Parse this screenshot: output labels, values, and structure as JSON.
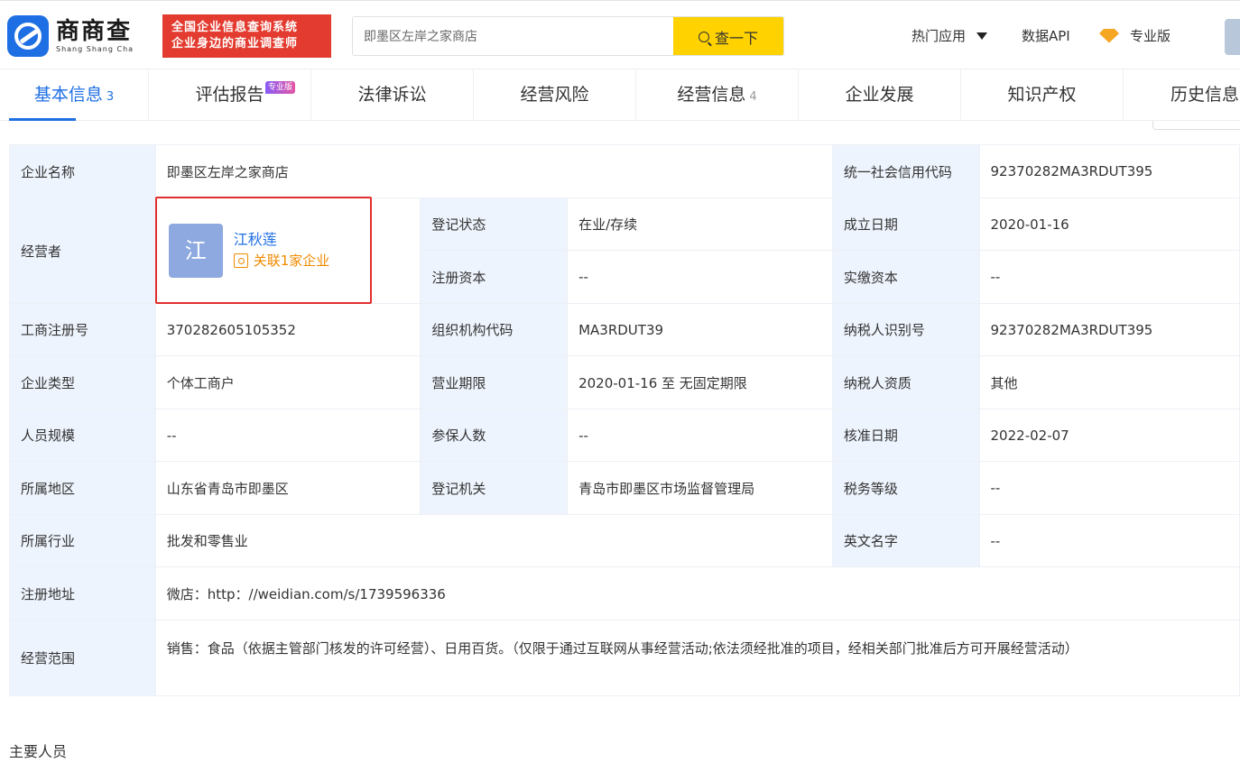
{
  "header": {
    "logo_cn": "商商查",
    "logo_en": "Shang Shang Cha",
    "slogan_line1": "全国企业信息查询系统",
    "slogan_line2": "企业身边的商业调查师",
    "search_value": "即墨区左岸之家商店",
    "search_button": "查一下",
    "hot_apps": "热门应用",
    "data_api": "数据API",
    "pro_version": "专业版",
    "icons": [
      "logo-icon",
      "search-icon",
      "caret-down-icon",
      "diamond-icon"
    ],
    "colors": {
      "brand": "#1f6fe4",
      "search_button": "#ffd200",
      "slogan_bg": "#e33b2f",
      "pro_diamond": "#f5a623"
    }
  },
  "tabs": [
    {
      "label": "基本信息",
      "count": "3",
      "active": true
    },
    {
      "label": "评估报告",
      "badge": "专业版"
    },
    {
      "label": "法律诉讼"
    },
    {
      "label": "经营风险"
    },
    {
      "label": "经营信息",
      "count": "4"
    },
    {
      "label": "企业发展"
    },
    {
      "label": "知识产权"
    },
    {
      "label": "历史信息"
    }
  ],
  "info": {
    "company_name_label": "企业名称",
    "company_name": "即墨区左岸之家商店",
    "credit_code_label": "统一社会信用代码",
    "credit_code": "92370282MA3RDUT395",
    "operator_label": "经营者",
    "operator_avatar": "江",
    "operator_name": "江秋莲",
    "operator_related": "关联1家企业",
    "reg_status_label": "登记状态",
    "reg_status": "在业/存续",
    "founded_label": "成立日期",
    "founded": "2020-01-16",
    "reg_capital_label": "注册资本",
    "reg_capital": "--",
    "paid_capital_label": "实缴资本",
    "paid_capital": "--",
    "biz_reg_no_label": "工商注册号",
    "biz_reg_no": "370282605105352",
    "org_code_label": "组织机构代码",
    "org_code": "MA3RDUT39",
    "taxpayer_id_label": "纳税人识别号",
    "taxpayer_id": "92370282MA3RDUT395",
    "type_label": "企业类型",
    "type": "个体工商户",
    "term_label": "营业期限",
    "term": "2020-01-16 至 无固定期限",
    "taxpayer_qual_label": "纳税人资质",
    "taxpayer_qual": "其他",
    "staff_size_label": "人员规模",
    "staff_size": "--",
    "insured_label": "参保人数",
    "insured": "--",
    "approved_label": "核准日期",
    "approved": "2022-02-07",
    "region_label": "所属地区",
    "region": "山东省青岛市即墨区",
    "authority_label": "登记机关",
    "authority": "青岛市即墨区市场监督管理局",
    "tax_grade_label": "税务等级",
    "tax_grade": "--",
    "industry_label": "所属行业",
    "industry": "批发和零售业",
    "english_name_label": "英文名字",
    "english_name": "--",
    "address_label": "注册地址",
    "address": "微店：http：//weidian.com/s/1739596336",
    "scope_label": "经营范围",
    "scope": "销售：食品（依据主管部门核发的许可经营）、日用百货。（仅限于通过互联网从事经营活动;依法须经批准的项目，经相关部门批准后方可开展经营活动）"
  },
  "section_title": "主要人员"
}
